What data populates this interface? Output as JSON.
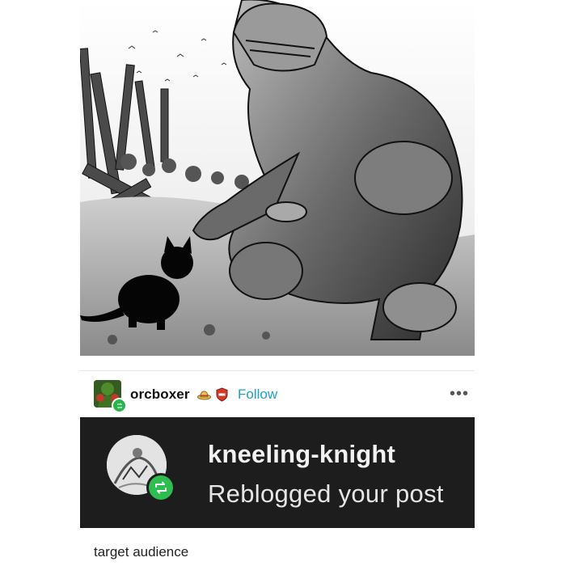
{
  "post": {
    "image_alt_icon": "knight-feeding-black-cat-illustration",
    "author": {
      "username": "orcboxer",
      "avatar_icon": "orc-boxer-avatar",
      "badges": [
        "straw-hat-icon",
        "red-shield-badge-icon"
      ],
      "follow_label": "Follow",
      "more_icon": "ellipsis-icon",
      "more_label": "•••"
    },
    "notification": {
      "username": "kneeling-knight",
      "action": "Reblogged your post",
      "avatar_icon": "knight-sketch-avatar",
      "badge_icon": "reblog-icon"
    },
    "caption": "target audience"
  },
  "colors": {
    "accent": "#1ea1c8",
    "reblog_green": "#2ebd4f",
    "card_bg": "#1d1d1d"
  }
}
